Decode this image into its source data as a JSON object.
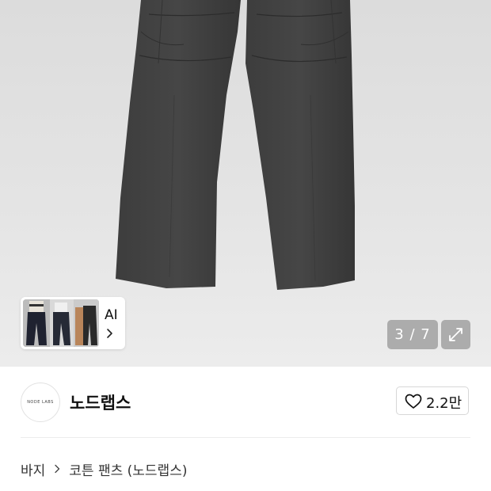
{
  "gallery": {
    "counter": "3 / 7",
    "ai_label": "AI"
  },
  "brand": {
    "logo_text": "NODE LABS",
    "name": "노드랩스",
    "likes": "2.2만"
  },
  "breadcrumb": {
    "category": "바지",
    "product": "코튼 팬츠 (노드랩스)"
  },
  "icons": {
    "ai_chevron": "chevron-right-icon",
    "expand": "expand-icon",
    "like": "heart-icon",
    "breadcrumb_separator": "chevron-right-icon"
  },
  "colors": {
    "pants": "#3a3a3a",
    "overlay": "#787878"
  }
}
